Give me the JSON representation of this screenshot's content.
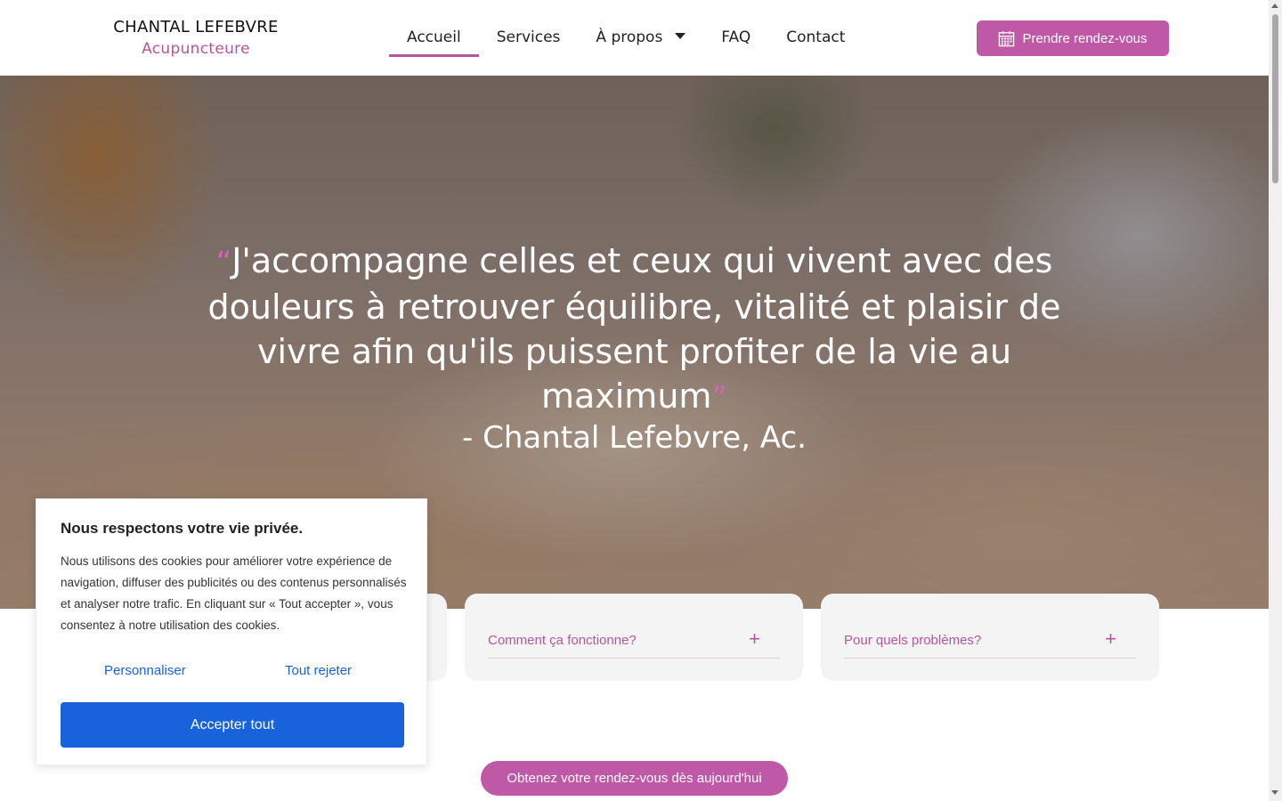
{
  "header": {
    "brand_name": "CHANTAL LEFEBVRE",
    "brand_sub": "Acupuncteure",
    "nav": [
      {
        "label": "Accueil",
        "active": true
      },
      {
        "label": "Services"
      },
      {
        "label": "À propos",
        "has_dropdown": true
      },
      {
        "label": "FAQ"
      },
      {
        "label": "Contact"
      }
    ],
    "cta_label": "Prendre rendez-vous",
    "cta_icon": "calendar-icon"
  },
  "hero": {
    "quote_open": "“",
    "quote": "J'accompagne celles et ceux qui vivent avec des douleurs à retrouver équilibre, vitalité et plaisir de vivre afin qu'ils puissent profiter de la vie au maximum",
    "quote_close": "”",
    "author": "- Chantal Lefebvre, Ac."
  },
  "accordion": [
    {
      "title": "Comment ça fonctionne?",
      "icon": "plus-icon"
    },
    {
      "title": "Pour quels problèmes?",
      "icon": "plus-icon"
    }
  ],
  "bottom_cta": "Obtenez votre rendez-vous dès aujourd'hui",
  "cookie": {
    "title": "Nous respectons votre vie privée.",
    "body": "Nous utilisons des cookies pour améliorer votre expérience de navigation, diffuser des publicités ou des contenus personnalisés et analyser notre trafic. En cliquant sur « Tout accepter », vous consentez à notre utilisation des cookies.",
    "customize": "Personnaliser",
    "reject": "Tout rejeter",
    "accept": "Accepter tout"
  },
  "colors": {
    "accent": "#c058a8",
    "cookie_blue": "#1863dc"
  }
}
